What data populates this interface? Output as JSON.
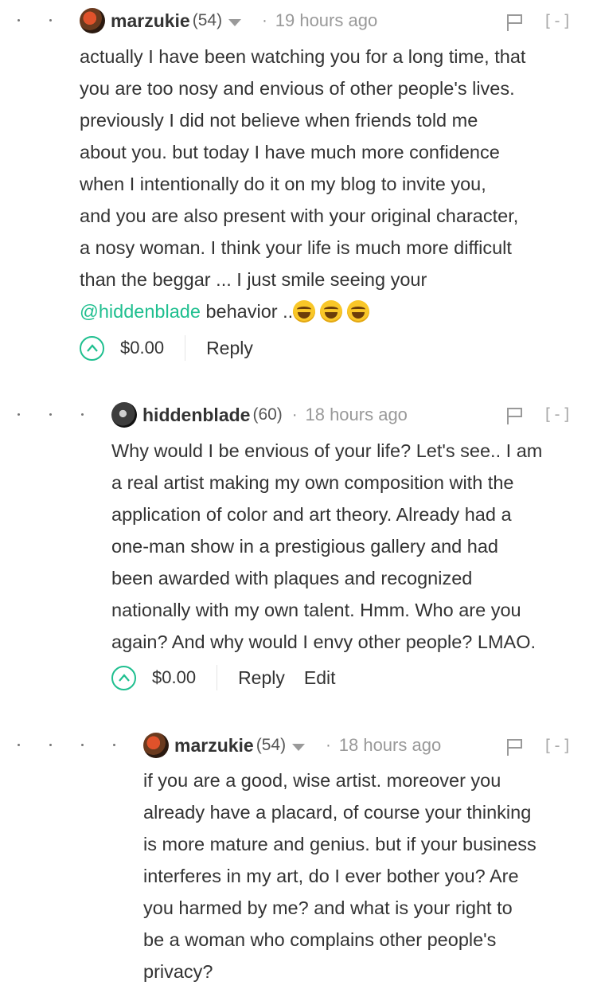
{
  "comments": [
    {
      "username": "marzukie",
      "reputation": "(54)",
      "separator": "·",
      "time": "19 hours ago",
      "collapse": "[-]",
      "lines": [
        "actually I have been watching you for a long time, that",
        "you are too nosy and envious of other people's lives.",
        "previously I did not believe when friends told me",
        "about you. but today I have much more confidence",
        "when I intentionally do it on my blog to invite you,",
        "and you are also present with your original character,",
        "a nosy woman. I think your life is much more difficult",
        "than the beggar ... I just smile seeing your"
      ],
      "mention": "@hiddenblade",
      "last_text": " behavior ..",
      "emoji": [
        "face-with-tears-of-joy-icon",
        "face-with-tears-of-joy-icon",
        "face-with-tears-of-joy-icon"
      ],
      "payout": "$0.00",
      "reply": "Reply"
    },
    {
      "username": "hiddenblade",
      "reputation": "(60)",
      "separator": "·",
      "time": "18 hours ago",
      "collapse": "[-]",
      "lines": [
        "Why would I be envious of your life? Let's see.. I am",
        "a real artist making my own composition with the",
        "application of color and art theory. Already had a",
        "one-man show in a prestigious gallery and had",
        "been awarded with plaques and recognized",
        "nationally with my own talent. Hmm. Who are you",
        "again? And why would I envy other people? LMAO."
      ],
      "payout": "$0.00",
      "reply": "Reply",
      "edit": "Edit"
    },
    {
      "username": "marzukie",
      "reputation": "(54)",
      "separator": "·",
      "time": "18 hours ago",
      "collapse": "[-]",
      "lines": [
        "if you are a good, wise artist. moreover you",
        "already have a placard, of course your thinking",
        "is more mature and genius. but if your business",
        "interferes in my art, do I ever bother you? Are",
        "you harmed by me? and what is your right to",
        "be a woman who complains other people's",
        "privacy?"
      ]
    }
  ],
  "colors": {
    "accent": "#1fbf8f",
    "text": "#333333",
    "muted": "#999999"
  }
}
